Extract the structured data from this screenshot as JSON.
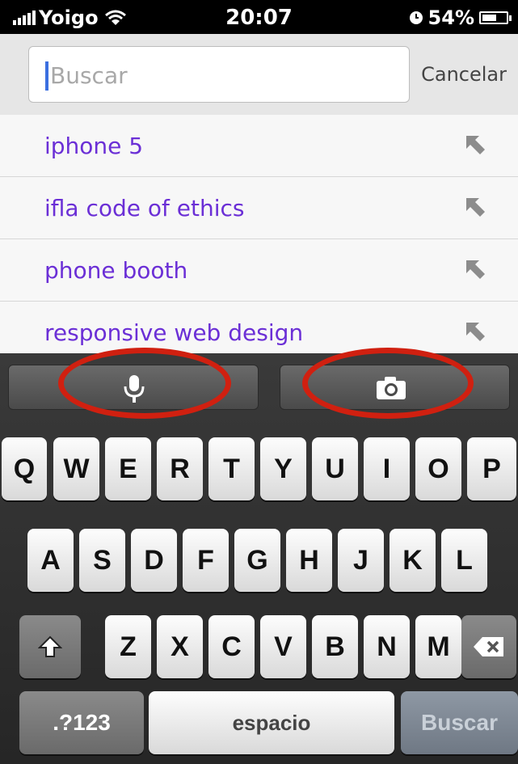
{
  "status_bar": {
    "carrier": "Yoigo",
    "time": "20:07",
    "battery": "54%"
  },
  "search": {
    "placeholder": "Buscar",
    "value": "",
    "cancel_label": "Cancelar"
  },
  "suggestions": [
    {
      "text": "iphone 5"
    },
    {
      "text": "ifla code of ethics"
    },
    {
      "text": "phone booth"
    },
    {
      "text": "responsive web design"
    }
  ],
  "keyboard": {
    "accessory": {
      "voice_icon": "microphone-icon",
      "camera_icon": "camera-icon"
    },
    "row1": [
      "Q",
      "W",
      "E",
      "R",
      "T",
      "Y",
      "U",
      "I",
      "O",
      "P"
    ],
    "row2": [
      "A",
      "S",
      "D",
      "F",
      "G",
      "H",
      "J",
      "K",
      "L"
    ],
    "row3": [
      "Z",
      "X",
      "C",
      "V",
      "B",
      "N",
      "M"
    ],
    "numbers_label": ".?123",
    "space_label": "espacio",
    "go_label": "Buscar"
  },
  "colors": {
    "suggestion_text": "#6b2fd6",
    "highlight": "#d02010",
    "caret": "#3b6fe0"
  }
}
